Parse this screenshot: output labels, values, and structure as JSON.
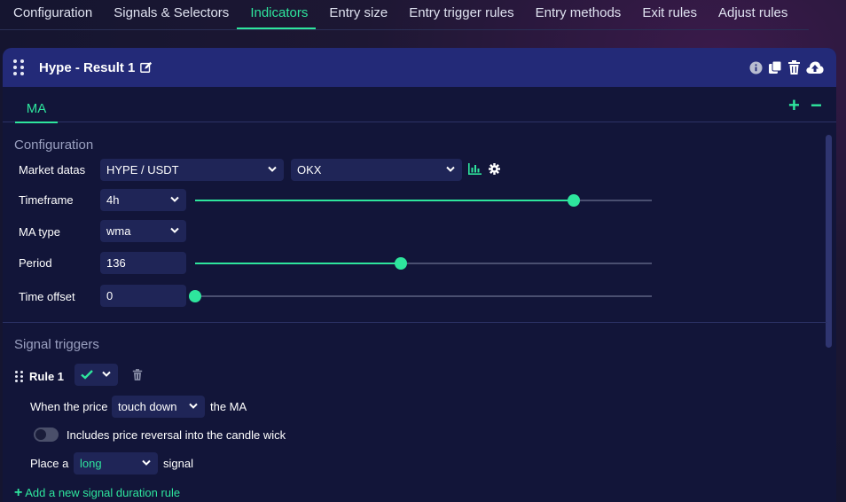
{
  "nav": {
    "tabs": [
      "Configuration",
      "Signals & Selectors",
      "Indicators",
      "Entry size",
      "Entry trigger rules",
      "Entry methods",
      "Exit rules",
      "Adjust rules"
    ],
    "active_index": 2
  },
  "panel": {
    "title": "Hype - Result 1",
    "subtab": "MA"
  },
  "configuration": {
    "section_title": "Configuration",
    "market_datas_label": "Market datas",
    "market_pair": "HYPE / USDT",
    "exchange": "OKX",
    "timeframe_label": "Timeframe",
    "timeframe_value": "4h",
    "timeframe_slider_fraction": 0.83,
    "ma_type_label": "MA type",
    "ma_type_value": "wma",
    "period_label": "Period",
    "period_value": "136",
    "period_slider_fraction": 0.45,
    "time_offset_label": "Time offset",
    "time_offset_value": "0",
    "time_offset_slider_fraction": 0.0
  },
  "signal_triggers": {
    "section_title": "Signal triggers",
    "rule_label": "Rule 1",
    "when_price_text": "When the price",
    "condition_value": "touch down",
    "the_ma_text": "the MA",
    "wick_toggle_label": "Includes price reversal into the candle wick",
    "place_a_text": "Place a",
    "direction_value": "long",
    "signal_text": "signal",
    "add_rule_link": "Add a new signal duration rule"
  },
  "colors": {
    "accent": "#2ee59d",
    "header_bg": "#232a78",
    "panel_bg": "#121539",
    "input_bg": "#1f2557"
  }
}
